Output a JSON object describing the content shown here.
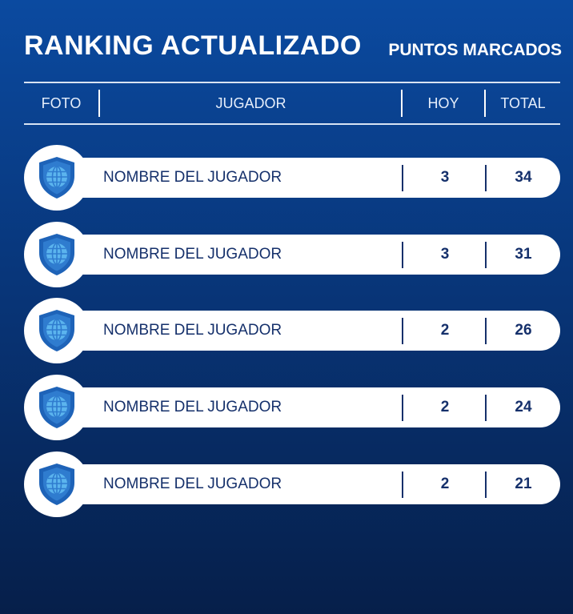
{
  "header": {
    "title": "RANKING ACTUALIZADO",
    "subtitle": "PUNTOS MARCADOS"
  },
  "columns": {
    "photo": "FOTO",
    "player": "JUGADOR",
    "today": "HOY",
    "total": "TOTAL"
  },
  "rows": [
    {
      "name": "NOMBRE DEL JUGADOR",
      "today": "3",
      "total": "34",
      "icon": "shield-globe-icon"
    },
    {
      "name": "NOMBRE DEL JUGADOR",
      "today": "3",
      "total": "31",
      "icon": "shield-globe-icon"
    },
    {
      "name": "NOMBRE DEL JUGADOR",
      "today": "2",
      "total": "26",
      "icon": "shield-globe-icon"
    },
    {
      "name": "NOMBRE DEL JUGADOR",
      "today": "2",
      "total": "24",
      "icon": "shield-globe-icon"
    },
    {
      "name": "NOMBRE DEL JUGADOR",
      "today": "2",
      "total": "21",
      "icon": "shield-globe-icon"
    }
  ],
  "colors": {
    "background_top": "#0b4aa0",
    "background_bottom": "#061f4a",
    "row_text": "#15306b",
    "shield": "#1e63b8",
    "globe": "#5bb4ee"
  }
}
